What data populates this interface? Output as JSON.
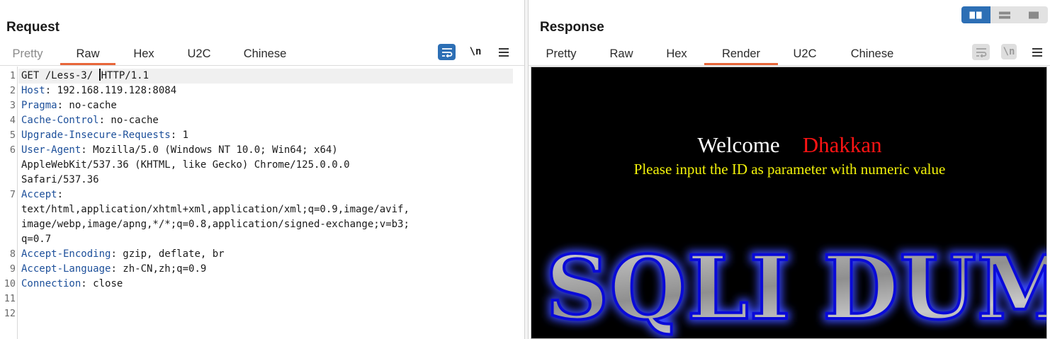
{
  "request": {
    "title": "Request",
    "tabs": [
      {
        "label": "Pretty",
        "state": "dim"
      },
      {
        "label": "Raw",
        "state": "active"
      },
      {
        "label": "Hex",
        "state": "normal"
      },
      {
        "label": "U2C",
        "state": "normal"
      },
      {
        "label": "Chinese",
        "state": "normal"
      }
    ],
    "tools": {
      "wrap_icon": "wrap-lines-icon",
      "newline_label": "\\n",
      "menu_icon": "hamburger-menu-icon"
    },
    "line_numbers": [
      "1",
      "2",
      "3",
      "4",
      "5",
      "6",
      "",
      "",
      "7",
      "",
      "",
      "",
      "8",
      "9",
      "10",
      "11",
      "12"
    ],
    "lines": [
      {
        "name": "",
        "value": "GET /Less-3/ "
      },
      {
        "name": "Host",
        "value": ": 192.168.119.128:8084"
      },
      {
        "name": "Pragma",
        "value": ": no-cache"
      },
      {
        "name": "Cache-Control",
        "value": ": no-cache"
      },
      {
        "name": "Upgrade-Insecure-Requests",
        "value": ": 1"
      },
      {
        "name": "User-Agent",
        "value": ": Mozilla/5.0 (Windows NT 10.0; Win64; x64)"
      },
      {
        "name": "",
        "value": "AppleWebKit/537.36 (KHTML, like Gecko) Chrome/125.0.0.0"
      },
      {
        "name": "",
        "value": "Safari/537.36"
      },
      {
        "name": "Accept",
        "value": ":"
      },
      {
        "name": "",
        "value": "text/html,application/xhtml+xml,application/xml;q=0.9,image/avif,"
      },
      {
        "name": "",
        "value": "image/webp,image/apng,*/*;q=0.8,application/signed-exchange;v=b3;"
      },
      {
        "name": "",
        "value": "q=0.7"
      },
      {
        "name": "Accept-Encoding",
        "value": ": gzip, deflate, br"
      },
      {
        "name": "Accept-Language",
        "value": ": zh-CN,zh;q=0.9"
      },
      {
        "name": "Connection",
        "value": ": close"
      }
    ],
    "first_line_tail": "HTTP/1.1"
  },
  "response": {
    "title": "Response",
    "tabs": [
      {
        "label": "Pretty",
        "state": "normal"
      },
      {
        "label": "Raw",
        "state": "normal"
      },
      {
        "label": "Hex",
        "state": "normal"
      },
      {
        "label": "Render",
        "state": "active"
      },
      {
        "label": "U2C",
        "state": "normal"
      },
      {
        "label": "Chinese",
        "state": "normal"
      }
    ],
    "tools": {
      "wrap_icon": "wrap-lines-icon",
      "newline_label": "\\n",
      "menu_icon": "hamburger-menu-icon"
    },
    "render": {
      "welcome": "Welcome",
      "name": "Dhakkan",
      "instruction": "Please input the ID as parameter with numeric value",
      "banner": "SQLI DUMB SERIES"
    }
  },
  "layout_switch": {
    "options": [
      "side-by-side-icon",
      "top-bottom-icon",
      "single-pane-icon"
    ],
    "active": "side-by-side-icon"
  },
  "colors": {
    "accent_tab": "#e8673a",
    "active_tool": "#2d6fb5",
    "header_name": "#1c4f9a",
    "render_bg": "#000000",
    "welcome_name": "#ff1414",
    "instruction": "#f2f20a"
  }
}
